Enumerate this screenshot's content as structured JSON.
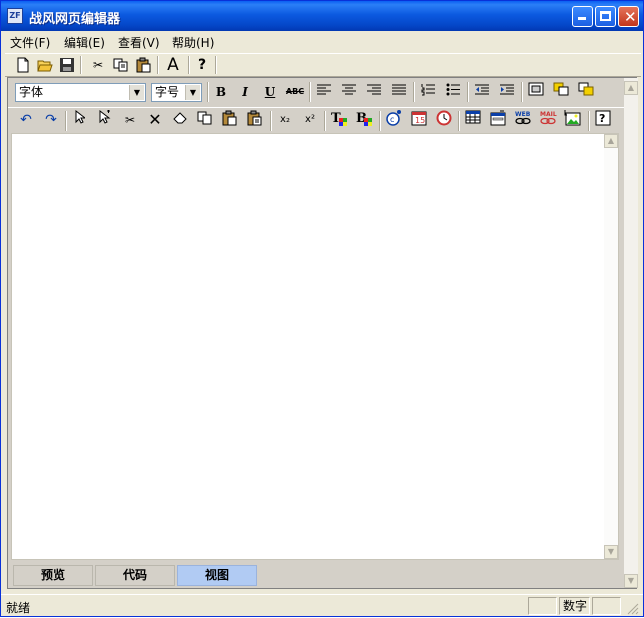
{
  "window": {
    "title": "战风网页编辑器",
    "icon": "zf-app-icon"
  },
  "menu": [
    {
      "label": "文件(F)"
    },
    {
      "label": "编辑(E)"
    },
    {
      "label": "查看(V)"
    },
    {
      "label": "帮助(H)"
    }
  ],
  "toolbar_main": [
    "new-file-icon",
    "open-folder-icon",
    "save-icon",
    "cut-icon",
    "copy-icon",
    "paste-icon",
    "font-icon",
    "help-icon"
  ],
  "format_bar": {
    "font_select": "字体",
    "size_select": "字号",
    "bold": "B",
    "italic": "I",
    "underline": "U",
    "strike": "ABC"
  },
  "edit_bar": {
    "subscript": "x₂",
    "superscript": "x²"
  },
  "tabs": [
    {
      "label": "预览",
      "active": false
    },
    {
      "label": "代码",
      "active": false
    },
    {
      "label": "视图",
      "active": true
    }
  ],
  "status": {
    "text": "就绪",
    "num_lock": "数字"
  },
  "colors": {
    "titlebar": "#0c5ae0",
    "face": "#ece9d8",
    "active_tab": "#b1cbf3"
  }
}
